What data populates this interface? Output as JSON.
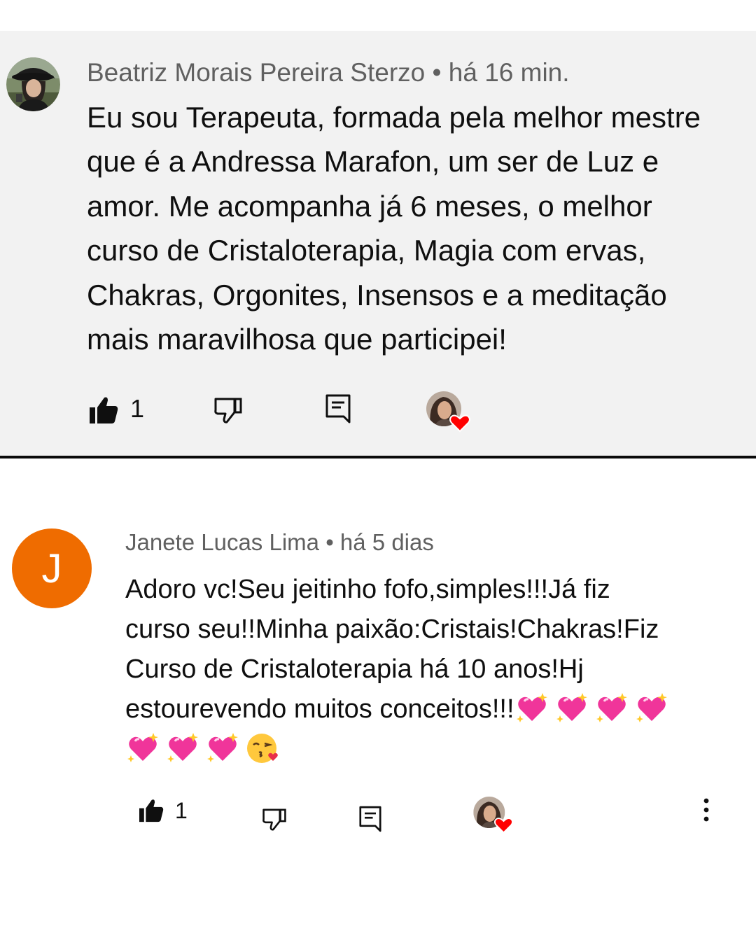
{
  "comments": [
    {
      "author": "Beatriz Morais Pereira Sterzo",
      "time": "há 16 min.",
      "lines": [
        "Eu sou Terapeuta, formada pela melhor mestre",
        "que é a Andressa Marafon, um ser de Luz e",
        "amor. Me acompanha já 6 meses, o melhor",
        "curso de Cristaloterapia, Magia com ervas,",
        "Chakras, Orgonites, Insensos e a meditação",
        "mais maravilhosa que participei!"
      ],
      "like_count": "1",
      "creator_hearted": true
    },
    {
      "author": "Janete Lucas Lima",
      "time": "há 5 dias",
      "avatar_letter": "J",
      "avatar_color": "#ef6c00",
      "lines": [
        "Adoro vc!Seu jeitinho fofo,simples!!!Já fiz",
        "curso seu!!Minha paixão:Cristais!Chakras!Fiz",
        "Curso de Cristaloterapia há 10 anos!Hj",
        "estourevendo muitos conceitos!!!"
      ],
      "emojis_line4": [
        "sparkling-heart",
        "sparkling-heart",
        "sparkling-heart",
        "sparkling-heart"
      ],
      "emojis_line5": [
        "sparkling-heart",
        "sparkling-heart",
        "sparkling-heart",
        "face-blowing-kiss"
      ],
      "like_count": "1",
      "creator_hearted": true
    }
  ],
  "separator": "•",
  "colors": {
    "card_bg": "#f2f2f2",
    "meta": "#606060",
    "heart": "#ff0000",
    "avatar_j": "#ef6c00"
  }
}
